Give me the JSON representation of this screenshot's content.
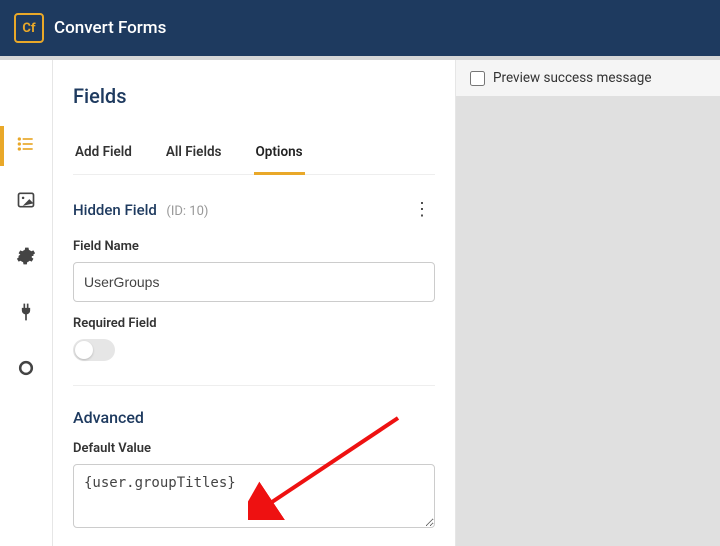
{
  "app": {
    "logo_text": "Cf",
    "title": "Convert Forms"
  },
  "panel": {
    "title": "Fields",
    "tabs": [
      {
        "label": "Add Field",
        "active": false
      },
      {
        "label": "All Fields",
        "active": false
      },
      {
        "label": "Options",
        "active": true
      }
    ],
    "section": {
      "title": "Hidden Field",
      "id_label": "(ID: 10)"
    },
    "field_name": {
      "label": "Field Name",
      "value": "UserGroups"
    },
    "required": {
      "label": "Required Field",
      "on": false
    },
    "advanced": {
      "heading": "Advanced"
    },
    "default_value": {
      "label": "Default Value",
      "value": "{user.groupTitles}"
    }
  },
  "rail": {
    "items": [
      {
        "name": "fields-list-icon",
        "active": true
      },
      {
        "name": "image-icon",
        "active": false
      },
      {
        "name": "gear-icon",
        "active": false
      },
      {
        "name": "plug-icon",
        "active": false
      },
      {
        "name": "circle-icon",
        "active": false
      }
    ]
  },
  "preview": {
    "checkbox_label": "Preview success message"
  }
}
